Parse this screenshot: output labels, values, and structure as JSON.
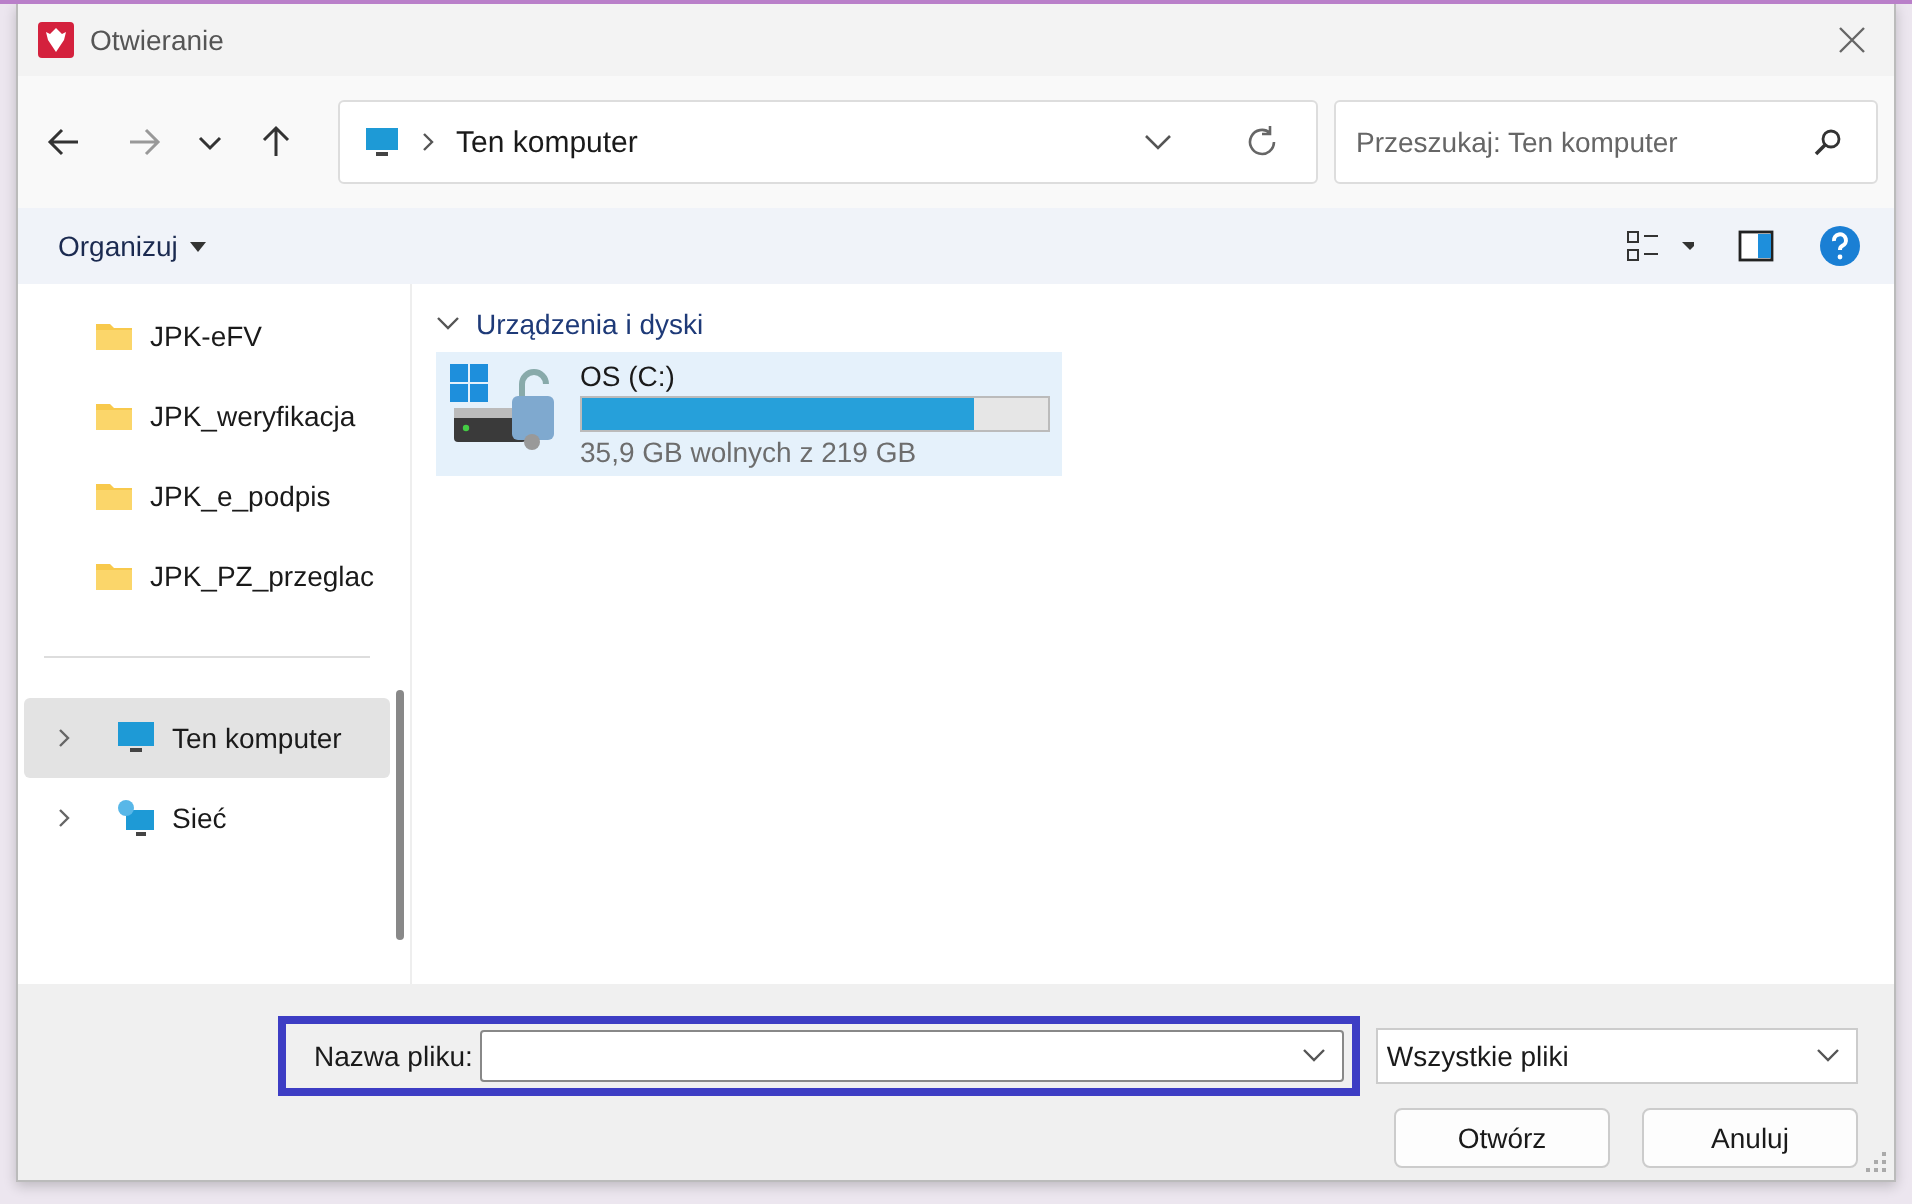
{
  "window": {
    "title": "Otwieranie"
  },
  "address": {
    "path": "Ten komputer"
  },
  "search": {
    "placeholder": "Przeszukaj: Ten komputer"
  },
  "toolbar": {
    "organize": "Organizuj"
  },
  "sidebar": {
    "items": [
      {
        "kind": "folder",
        "label": "JPK-eFV",
        "selected": false
      },
      {
        "kind": "folder",
        "label": "JPK_weryfikacja",
        "selected": false
      },
      {
        "kind": "folder",
        "label": "JPK_e_podpis",
        "selected": false
      },
      {
        "kind": "folder",
        "label": "JPK_PZ_przeglac",
        "selected": false
      },
      {
        "kind": "separator"
      },
      {
        "kind": "computer",
        "label": "Ten komputer",
        "selected": true
      },
      {
        "kind": "network",
        "label": "Sieć",
        "selected": false
      }
    ]
  },
  "content": {
    "group": "Urządzenia i dyski",
    "expanded": true,
    "drives": [
      {
        "name": "OS (C:)",
        "level": 0.84,
        "reading": "35,9 GB wolnych z 219 GB",
        "selected": true
      }
    ]
  },
  "footer": {
    "filename_label": "Nazwa pliku:",
    "filename_highlighted": true,
    "filetype": "Wszystkie pliki",
    "buttons": [
      "Otwórz",
      "Anuluj"
    ]
  }
}
